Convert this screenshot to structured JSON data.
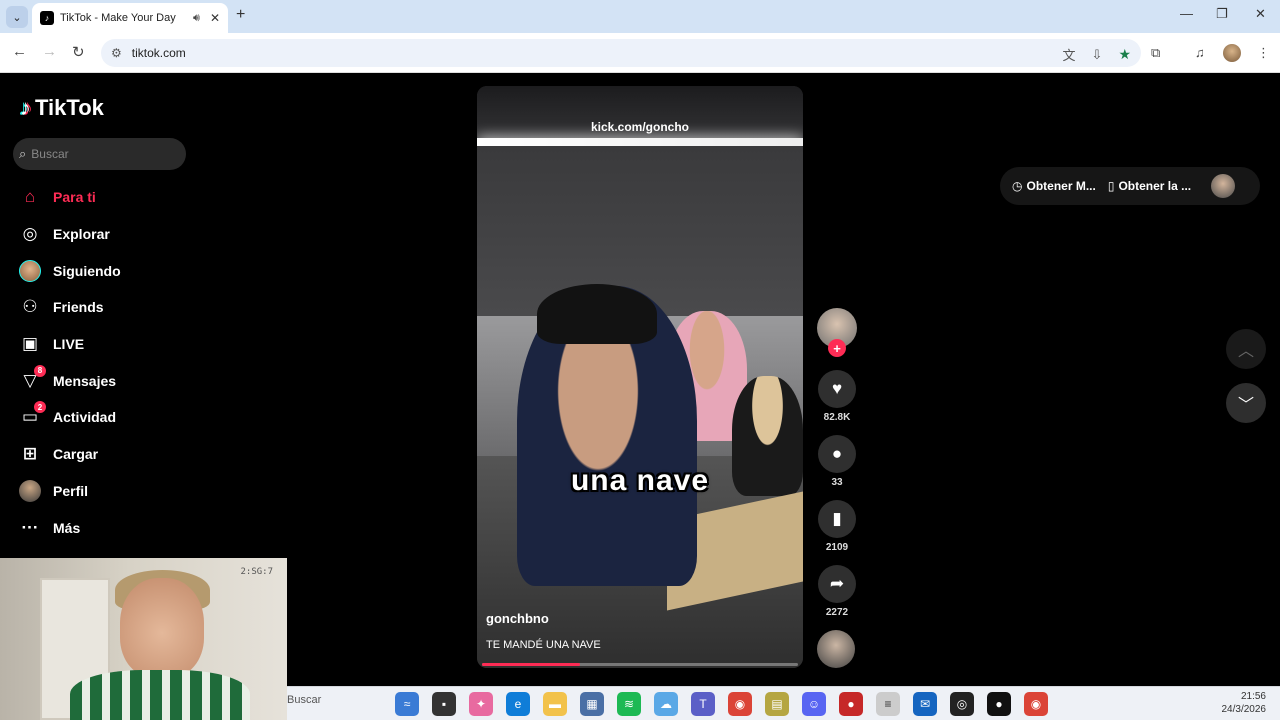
{
  "browser": {
    "tab_title": "TikTok - Make Your Day",
    "url": "tiktok.com"
  },
  "sidebar": {
    "logo": "TikTok",
    "search_placeholder": "Buscar",
    "items": [
      {
        "label": "Para ti",
        "icon": "home-icon",
        "active": true
      },
      {
        "label": "Explorar",
        "icon": "compass-icon"
      },
      {
        "label": "Siguiendo",
        "icon": "following-avatar"
      },
      {
        "label": "Friends",
        "icon": "friends-icon"
      },
      {
        "label": "LIVE",
        "icon": "live-icon"
      },
      {
        "label": "Mensajes",
        "icon": "messages-icon",
        "badge": "8"
      },
      {
        "label": "Actividad",
        "icon": "activity-icon",
        "badge": "2"
      },
      {
        "label": "Cargar",
        "icon": "upload-icon"
      },
      {
        "label": "Perfil",
        "icon": "profile-avatar"
      },
      {
        "label": "Más",
        "icon": "more-icon"
      }
    ]
  },
  "webcam": {
    "clock_text": "2:SG:7"
  },
  "video": {
    "watermark": "kick.com/goncho",
    "caption": "una nave",
    "author": "gonchbno",
    "description": "TE MANDÉ UNA NAVE",
    "progress": 0.31
  },
  "actions": {
    "likes": "82.8K",
    "comments": "33",
    "saves": "2109",
    "shares": "2272"
  },
  "header": {
    "coins_label": "Obtener M...",
    "app_label": "Obtener la ..."
  },
  "taskbar": {
    "search_label": "Buscar",
    "time": "21:56",
    "date": "24/3/2026"
  },
  "colors": {
    "accent": "#fe2c55",
    "background": "#000000"
  }
}
